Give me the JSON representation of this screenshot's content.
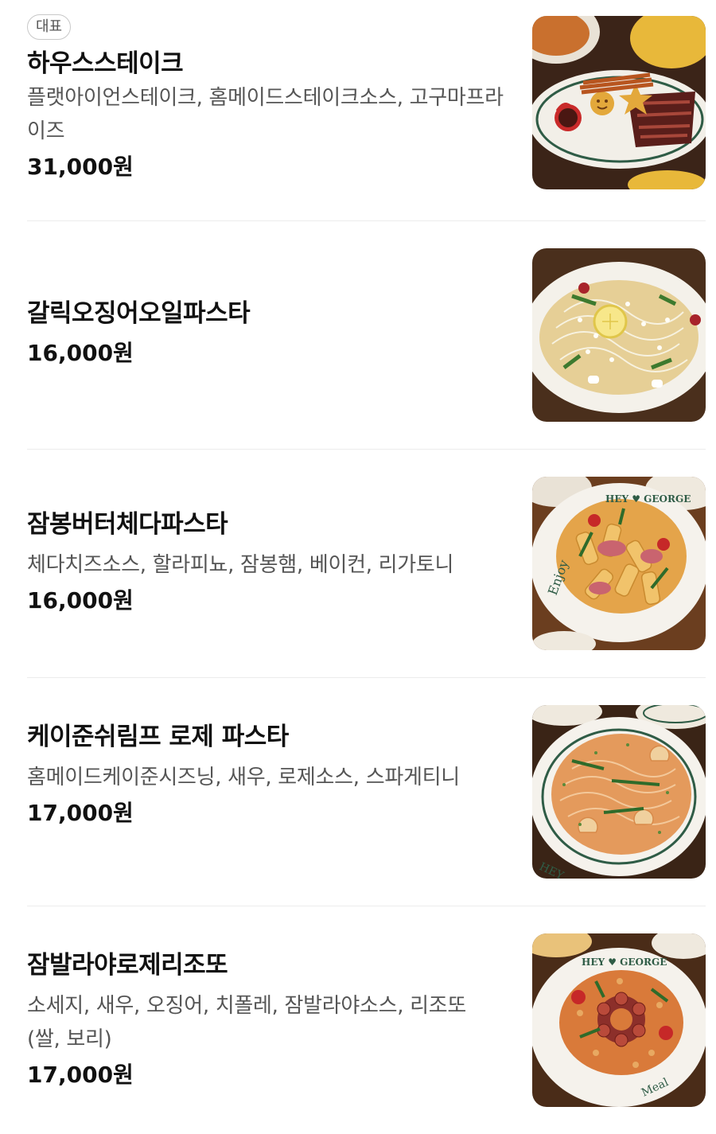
{
  "menu": {
    "items": [
      {
        "badge": "대표",
        "name": "하우스스테이크",
        "description": "플랫아이언스테이크, 홈메이드스테이크소스, 고구마프라이즈",
        "price": "31,000원",
        "image_icon": "steak-photo"
      },
      {
        "name": "갈릭오징어오일파스타",
        "price": "16,000원",
        "image_icon": "garlic-squid-pasta-photo"
      },
      {
        "name": "잠봉버터체다파스타",
        "description": "체다치즈소스, 할라피뇨, 잠봉햄, 베이컨, 리가토니",
        "price": "16,000원",
        "image_icon": "cheddar-rigatoni-photo"
      },
      {
        "name": "케이준쉬림프 로제 파스타",
        "description": "홈메이드케이준시즈닝, 새우, 로제소스, 스파게티니",
        "price": "17,000원",
        "image_icon": "shrimp-rose-pasta-photo"
      },
      {
        "name": "잠발라야로제리조또",
        "description": "소세지, 새우, 오징어, 치폴레, 잠발라야소스, 리조또 (쌀, 보리)",
        "price": "17,000원",
        "image_icon": "jambalaya-risotto-photo"
      }
    ]
  },
  "colors": {
    "text_primary": "#111111",
    "text_secondary": "#555555",
    "divider": "#ececec",
    "badge_border": "#c8c8c8"
  }
}
